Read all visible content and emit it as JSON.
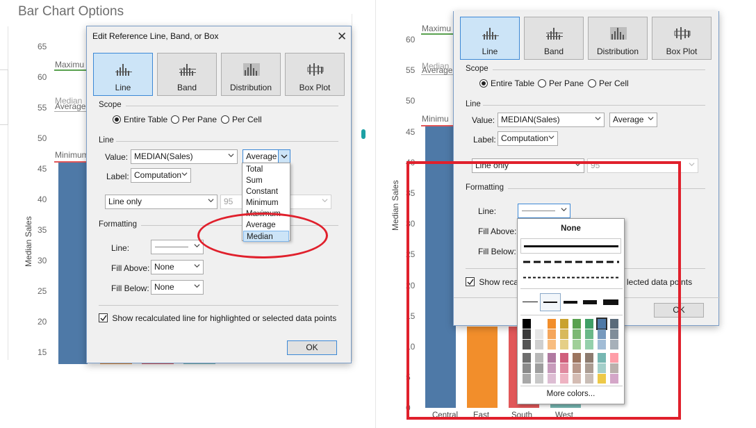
{
  "left": {
    "page_title": "Bar Chart Options",
    "axis_title": "Median Sales",
    "ticks": [
      "65",
      "60",
      "55",
      "50",
      "45",
      "40",
      "35",
      "30",
      "25",
      "20",
      "15"
    ],
    "ref_labels": {
      "maximum": "Maximu",
      "median": "Median",
      "average": "Average",
      "minimum": "Minimum"
    },
    "dialog": {
      "title": "Edit Reference Line, Band, or Box",
      "close": "✕",
      "types": [
        {
          "label": "Line",
          "selected": true,
          "icon": "line-chart-icon"
        },
        {
          "label": "Band",
          "selected": false,
          "icon": "band-chart-icon"
        },
        {
          "label": "Distribution",
          "selected": false,
          "icon": "distribution-chart-icon"
        },
        {
          "label": "Box Plot",
          "selected": false,
          "icon": "box-plot-icon"
        }
      ],
      "scope": {
        "heading": "Scope",
        "options": [
          {
            "label": "Entire Table",
            "checked": true
          },
          {
            "label": "Per Pane",
            "checked": false
          },
          {
            "label": "Per Cell",
            "checked": false
          }
        ]
      },
      "line": {
        "heading": "Line",
        "value_label": "Value:",
        "value_field": "MEDIAN(Sales)",
        "aggregation": "Average",
        "label_label": "Label:",
        "label_value": "Computation",
        "confidence_select": "Line only",
        "confidence_value": "95"
      },
      "aggregation_menu": {
        "options": [
          "Total",
          "Sum",
          "Constant",
          "Minimum",
          "Maximum",
          "Average",
          "Median"
        ],
        "selected": "Median"
      },
      "formatting": {
        "heading": "Formatting",
        "line_label": "Line:",
        "fill_above_label": "Fill Above:",
        "fill_above": "None",
        "fill_below_label": "Fill Below:",
        "fill_below": "None"
      },
      "recalc_checkbox": {
        "label": "Show recalculated line for highlighted or selected data points",
        "checked": true
      },
      "ok": "OK"
    }
  },
  "right": {
    "axis_title": "Median Sales",
    "ticks": [
      "60",
      "55",
      "50",
      "45",
      "40",
      "35",
      "30",
      "25",
      "20",
      "15",
      "10",
      "5",
      "0"
    ],
    "ref_labels": {
      "maximum": "Maximu",
      "median": "Median",
      "average": "Average",
      "minimum": "Minimu"
    },
    "categories": [
      "Central",
      "East",
      "South",
      "West"
    ],
    "dialog": {
      "types": [
        "Line",
        "Band",
        "Distribution",
        "Box Plot"
      ],
      "scope": {
        "heading": "Scope",
        "options": [
          {
            "label": "Entire Table",
            "checked": true
          },
          {
            "label": "Per Pane",
            "checked": false
          },
          {
            "label": "Per Cell",
            "checked": false
          }
        ]
      },
      "line": {
        "heading": "Line",
        "value_label": "Value:",
        "value_field": "MEDIAN(Sales)",
        "aggregation": "Average",
        "label_label": "Label:",
        "label_value": "Computation",
        "confidence_select": "Line only",
        "confidence_value": "95"
      },
      "formatting": {
        "heading": "Formatting",
        "line_label": "Line:",
        "fill_above_label": "Fill Above:",
        "fill_below_label": "Fill Below:"
      },
      "recalc_checkbox_label": "Show recalc",
      "recalc_checkbox_tail": "lected data points",
      "ok": "OK"
    },
    "line_style_popup": {
      "none_label": "None",
      "more_colors": "More colors..."
    }
  },
  "colors": {
    "bar_central": "#4e79a7",
    "bar_east": "#f28e2b",
    "bar_south": "#e15759",
    "bar_west": "#76b7b2",
    "max_line": "#59a14f",
    "median_line": "#999999",
    "min_line": "#e15759",
    "highlight": "#e0202c"
  }
}
